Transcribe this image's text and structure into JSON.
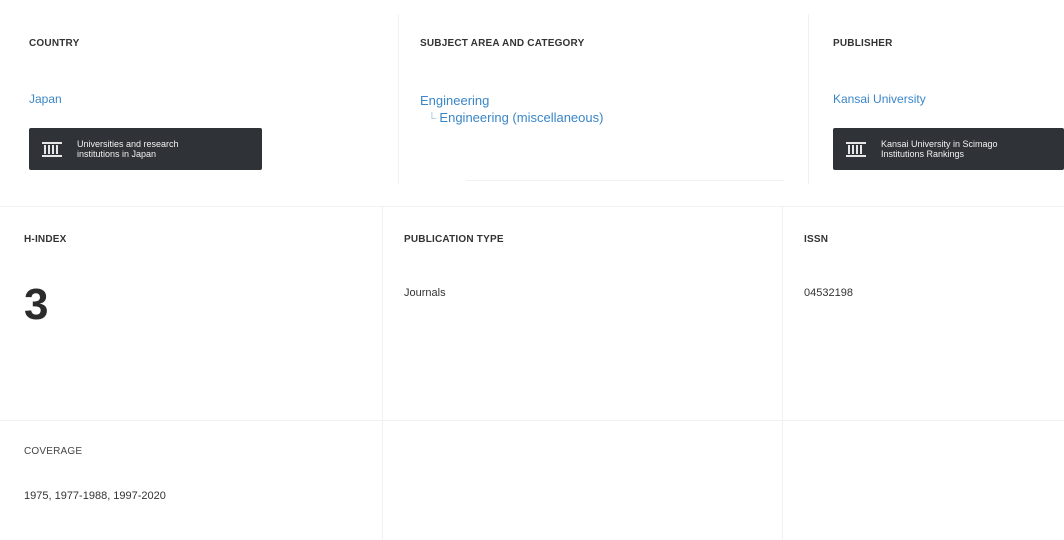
{
  "country": {
    "heading": "COUNTRY",
    "value": "Japan",
    "button_label_line1": "Universities and research",
    "button_label_line2": "institutions in Japan",
    "button_icon": "institution-icon"
  },
  "subject": {
    "heading": "SUBJECT AREA AND CATEGORY",
    "area": "Engineering",
    "category": "Engineering (miscellaneous)"
  },
  "publisher": {
    "heading": "PUBLISHER",
    "value": "Kansai University",
    "button_label_line1": "Kansai University in Scimago",
    "button_label_line2": "Institutions Rankings",
    "button_icon": "institution-icon"
  },
  "hindex": {
    "heading": "H-INDEX",
    "value": "3"
  },
  "publication_type": {
    "heading": "PUBLICATION TYPE",
    "value": "Journals"
  },
  "issn": {
    "heading": "ISSN",
    "value": "04532198"
  },
  "coverage": {
    "heading": "COVERAGE",
    "value": "1975, 1977-1988, 1997-2020"
  },
  "colors": {
    "link": "#3a86c8",
    "button_bg": "#2f3337",
    "text": "#333333"
  }
}
